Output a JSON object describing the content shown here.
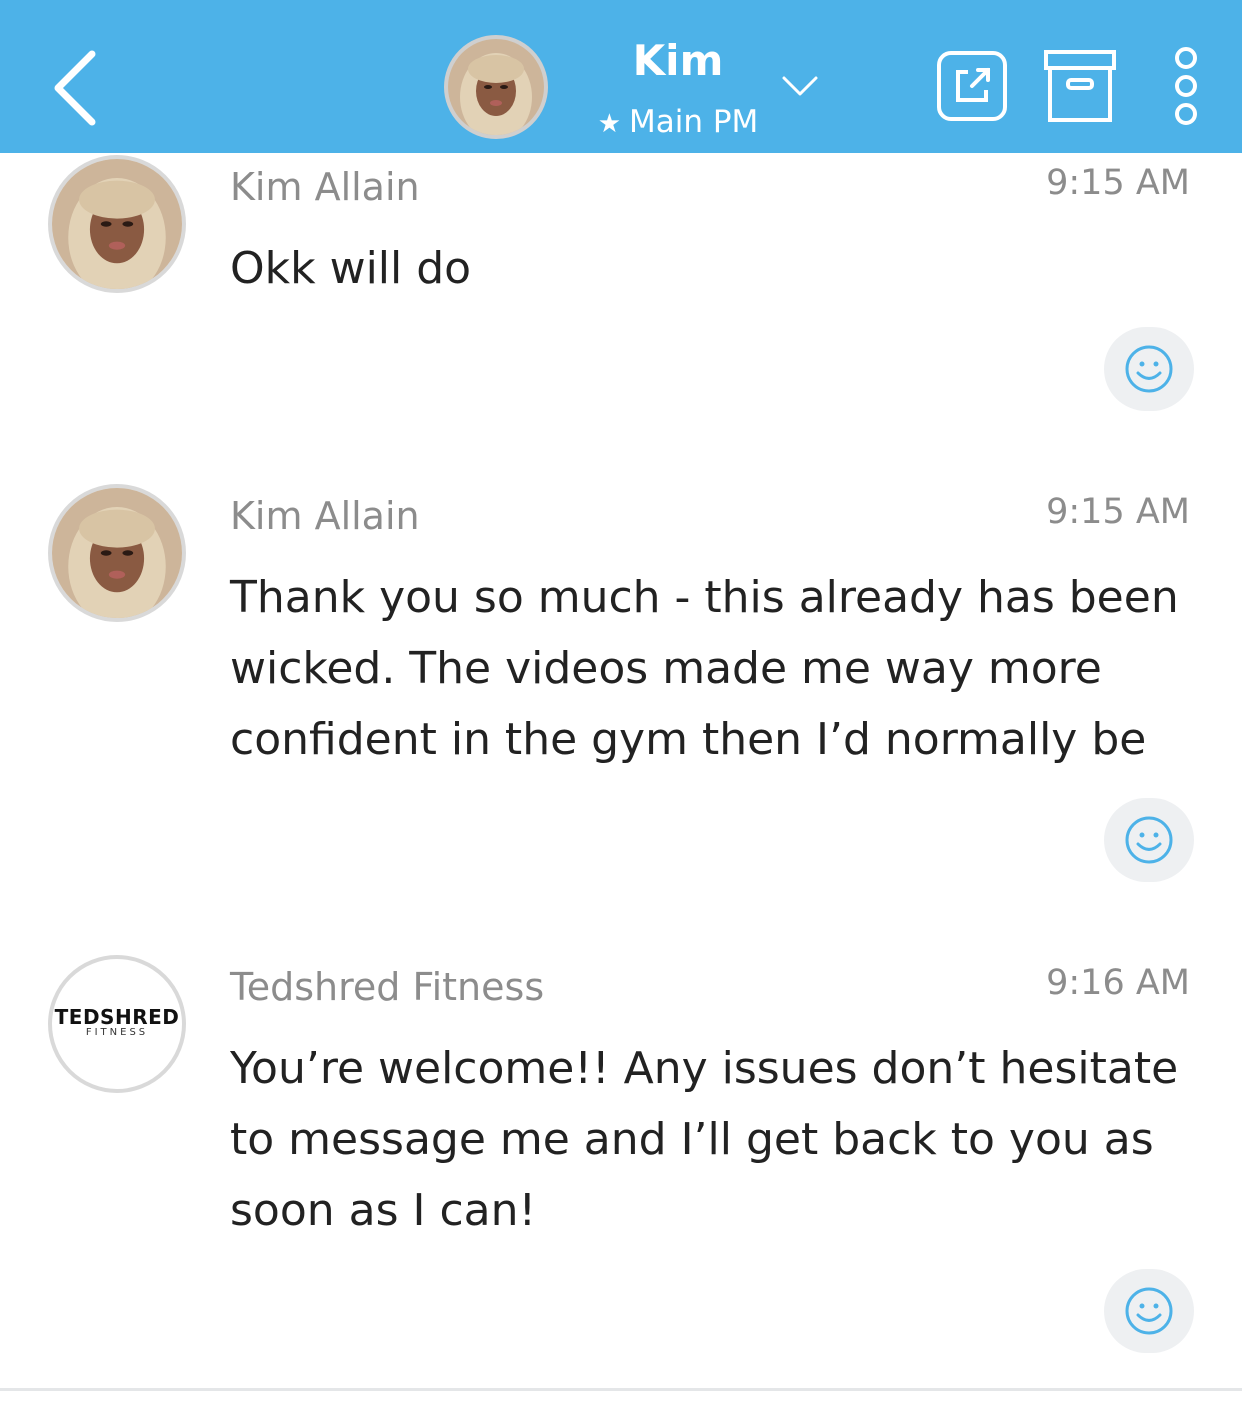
{
  "header": {
    "title": "Kim",
    "subtitle": "Main PM",
    "subtitle_icon": "star-icon",
    "accent_color": "#4db2e8"
  },
  "messages": [
    {
      "sender": "Kim Allain",
      "time": "9:15 AM",
      "text": "Okk will do",
      "avatar": "profile-photo"
    },
    {
      "sender": "Kim Allain",
      "time": "9:15 AM",
      "text": "Thank you so much - this already has been wicked. The videos made me way more confident in the gym then I’d normally be",
      "avatar": "profile-photo"
    },
    {
      "sender": "Tedshred Fitness",
      "time": "9:16 AM",
      "text": "You’re welcome!! Any issues don’t hesitate to message me and I’ll get back to you as soon as I can!",
      "avatar": "brand-logo"
    }
  ],
  "brand_logo": {
    "line1": "TEDSHRED",
    "line2": "FITNESS"
  }
}
